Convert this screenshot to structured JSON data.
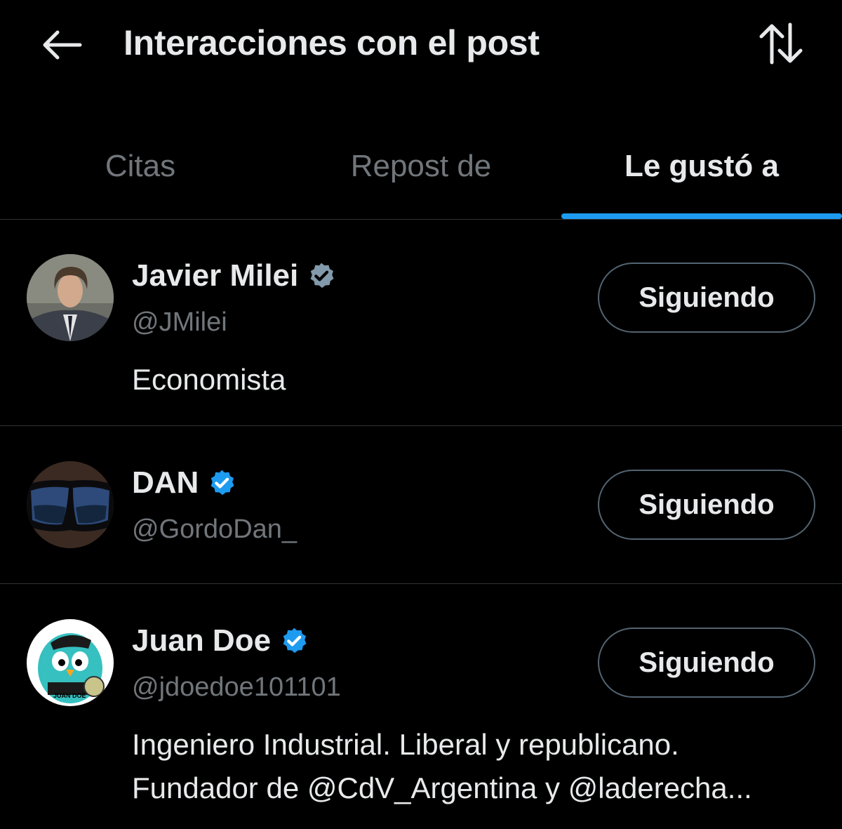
{
  "header": {
    "title": "Interacciones con el post",
    "back_icon": "arrow-left-icon",
    "sort_icon": "sort-arrows-icon"
  },
  "tabs": [
    {
      "label": "Citas",
      "active": false
    },
    {
      "label": "Repost de",
      "active": false
    },
    {
      "label": "Le gustó a",
      "active": true
    }
  ],
  "colors": {
    "background": "#000000",
    "accent": "#1d9bf0",
    "verified_gray": "#829aab",
    "text_primary": "#e7e9ea",
    "text_secondary": "#71767b"
  },
  "users": [
    {
      "name": "Javier Milei",
      "handle": "@JMilei",
      "verified": "gray",
      "bio": "Economista",
      "bio_line2": "",
      "button": "Siguiendo"
    },
    {
      "name": "DAN",
      "handle": "@GordoDan_",
      "verified": "blue",
      "bio": "",
      "bio_line2": "",
      "button": "Siguiendo"
    },
    {
      "name": "Juan Doe",
      "handle": "@jdoedoe101101",
      "verified": "blue",
      "bio": "Ingeniero Industrial. Liberal y republicano.",
      "bio_line2": "Fundador de @CdV_Argentina y @laderecha...",
      "avatar_text": "JUAN DOE",
      "button": "Siguiendo"
    }
  ]
}
